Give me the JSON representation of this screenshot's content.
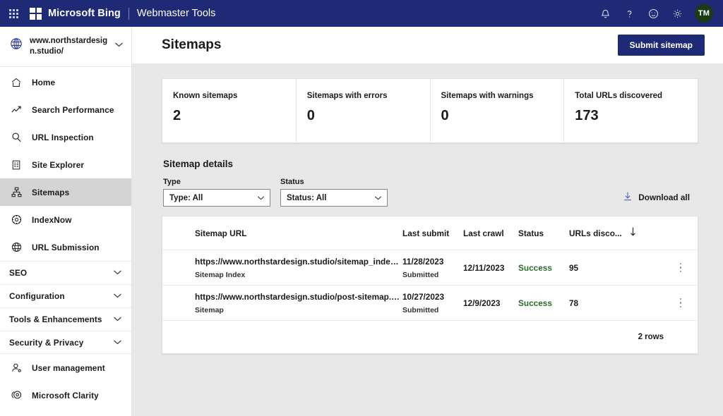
{
  "topbar": {
    "waffle_icon": "app-launcher-icon",
    "logo_icon": "microsoft-bing-logo",
    "brand": "Microsoft Bing",
    "product": "Webmaster Tools",
    "actions": [
      {
        "icon": "bell-icon",
        "name": "notifications-button"
      },
      {
        "icon": "question-icon",
        "name": "help-button"
      },
      {
        "icon": "smiley-icon",
        "name": "feedback-button"
      },
      {
        "icon": "gear-icon",
        "name": "settings-button"
      }
    ],
    "avatar_initials": "TM",
    "avatar_color": "#1b3a16",
    "background_color": "#1f2a77"
  },
  "sidebar": {
    "site": {
      "icon": "globe-icon",
      "url": "www.northstardesign.studio/",
      "chevron_icon": "chevron-down-icon"
    },
    "items": [
      {
        "label": "Home",
        "icon": "home-icon",
        "active": false
      },
      {
        "label": "Search Performance",
        "icon": "trend-line-icon",
        "active": false
      },
      {
        "label": "URL Inspection",
        "icon": "magnifier-icon",
        "active": false
      },
      {
        "label": "Site Explorer",
        "icon": "document-list-icon",
        "active": false
      },
      {
        "label": "Sitemaps",
        "icon": "sitemap-icon",
        "active": true
      },
      {
        "label": "IndexNow",
        "icon": "gear-circle-icon",
        "active": false
      },
      {
        "label": "URL Submission",
        "icon": "globe-grid-icon",
        "active": false
      }
    ],
    "groups": [
      {
        "label": "SEO",
        "chevron_icon": "chevron-down-icon"
      },
      {
        "label": "Configuration",
        "chevron_icon": "chevron-down-icon"
      },
      {
        "label": "Tools & Enhancements",
        "chevron_icon": "chevron-down-icon"
      },
      {
        "label": "Security & Privacy",
        "chevron_icon": "chevron-down-icon"
      }
    ],
    "footer_items": [
      {
        "label": "User management",
        "icon": "user-settings-icon"
      },
      {
        "label": "Microsoft Clarity",
        "icon": "clarity-icon"
      }
    ]
  },
  "page": {
    "title": "Sitemaps",
    "submit_button": "Submit sitemap",
    "accent_color": "#1f2a77"
  },
  "stats": [
    {
      "label": "Known sitemaps",
      "value": "2"
    },
    {
      "label": "Sitemaps with errors",
      "value": "0"
    },
    {
      "label": "Sitemaps with warnings",
      "value": "0"
    },
    {
      "label": "Total URLs discovered",
      "value": "173"
    }
  ],
  "details": {
    "section_title": "Sitemap details",
    "filters": [
      {
        "label": "Type",
        "value": "Type: All",
        "name": "type-filter"
      },
      {
        "label": "Status",
        "value": "Status: All",
        "name": "status-filter"
      }
    ],
    "download_all": {
      "label": "Download all",
      "icon": "download-icon"
    },
    "table": {
      "columns": [
        "Sitemap URL",
        "Last submit",
        "Last crawl",
        "Status",
        "URLs disco..."
      ],
      "sort_icon": "sort-descending-arrow-icon",
      "rows": [
        {
          "url": "https://www.northstardesign.studio/sitemap_index.xml",
          "type": "Sitemap Index",
          "last_submit": "11/28/2023",
          "submit_state": "Submitted",
          "last_crawl": "12/11/2023",
          "status": "Success",
          "urls_discovered": "95",
          "menu_icon": "kebab-menu-icon"
        },
        {
          "url": "https://www.northstardesign.studio/post-sitemap.xml",
          "type": "Sitemap",
          "last_submit": "10/27/2023",
          "submit_state": "Submitted",
          "last_crawl": "12/9/2023",
          "status": "Success",
          "urls_discovered": "78",
          "menu_icon": "kebab-menu-icon"
        }
      ],
      "row_count_label": "2 rows",
      "status_color": "#2b6b2b"
    }
  }
}
